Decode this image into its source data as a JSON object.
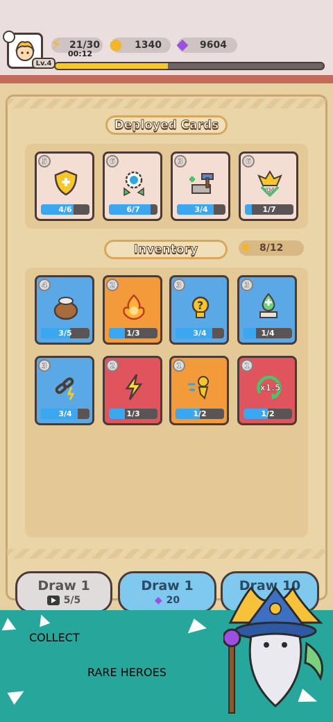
{
  "player": {
    "level": "Lv.4",
    "xp_fraction": 0.42
  },
  "resources": {
    "energy": "21/30",
    "energy_timer": "00:12",
    "gold": "1340",
    "gems": "9604"
  },
  "deployed": {
    "title": "Deployed Cards",
    "cards": [
      {
        "cost": "5",
        "progress": "4/6",
        "fill": 0.67,
        "icon": "shield-plus-icon",
        "color": "cream"
      },
      {
        "cost": "6",
        "progress": "6/7",
        "fill": 0.86,
        "icon": "gear-arrows-icon",
        "color": "cream"
      },
      {
        "cost": "3",
        "progress": "3/4",
        "fill": 0.75,
        "icon": "hammer-anvil-icon",
        "color": "cream"
      },
      {
        "cost": "6",
        "progress": "1/7",
        "fill": 0.14,
        "icon": "level-up-hero-icon",
        "color": "cream"
      }
    ]
  },
  "inventory": {
    "title": "Inventory",
    "count": "8/12",
    "cards": [
      {
        "cost": "4",
        "progress": "3/5",
        "fill": 0.6,
        "icon": "money-bag-icon",
        "color": "blue"
      },
      {
        "cost": "2",
        "progress": "1/3",
        "fill": 0.33,
        "icon": "fire-hero-icon",
        "color": "orange"
      },
      {
        "cost": "3",
        "progress": "3/4",
        "fill": 0.75,
        "icon": "mystery-hero-icon",
        "color": "blue"
      },
      {
        "cost": "3",
        "progress": "1/4",
        "fill": 0.25,
        "icon": "upgrade-potion-icon",
        "color": "blue"
      },
      {
        "cost": "3",
        "progress": "3/4",
        "fill": 0.75,
        "icon": "chain-lightning-icon",
        "color": "blue"
      },
      {
        "cost": "2",
        "progress": "1/3",
        "fill": 0.33,
        "icon": "lightning-icon",
        "color": "red"
      },
      {
        "cost": "1",
        "progress": "1/2",
        "fill": 0.5,
        "icon": "dash-hero-icon",
        "color": "orange"
      },
      {
        "cost": "1",
        "progress": "1/2",
        "fill": 0.5,
        "icon": "speed-x15-icon",
        "color": "red"
      }
    ]
  },
  "draw_buttons": [
    {
      "label": "Draw 1",
      "sub": "5/5",
      "icon": "video-icon"
    },
    {
      "label": "Draw 1",
      "sub": "20",
      "icon": "gem-icon"
    },
    {
      "label": "Draw 10",
      "sub": "",
      "icon": ""
    }
  ],
  "banner": {
    "line1": "COLLECT",
    "line2": "RARE HEROES"
  },
  "colors": {
    "blue_card": "#5aa9e6",
    "orange_card": "#f39a3a",
    "red_card": "#e0545e",
    "xp": "#f6c72b"
  }
}
